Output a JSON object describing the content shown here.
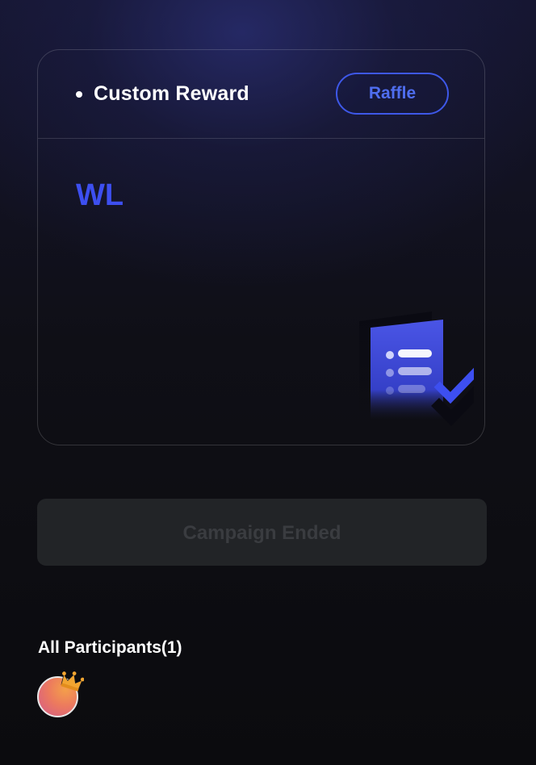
{
  "reward_card": {
    "type_label": "Custom Reward",
    "method_label": "Raffle",
    "reward_value": "WL",
    "illustration_icon": "checklist-document-icon"
  },
  "campaign_status": {
    "label": "Campaign Ended"
  },
  "participants": {
    "title": "All Participants(1)",
    "avatar_icon": "user-avatar",
    "badge_icon": "crown-icon"
  },
  "colors": {
    "accent": "#3d4ff0",
    "raffle_border": "#3e58e8",
    "disabled_button_bg": "#222427",
    "disabled_button_text": "#3a3c40"
  }
}
